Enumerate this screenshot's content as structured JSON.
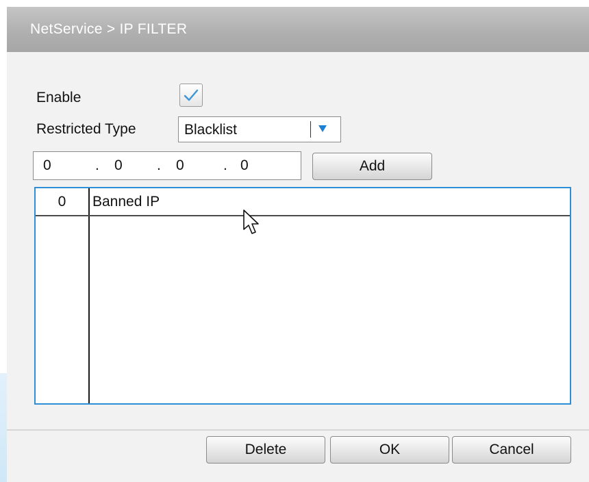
{
  "dialog": {
    "title": "NetService > IP FILTER"
  },
  "enable": {
    "label": "Enable",
    "checked": true,
    "icon": "checkmark-icon"
  },
  "restricted_type": {
    "label": "Restricted Type",
    "value": "Blacklist",
    "icon": "dropdown-arrow-icon"
  },
  "ip_input": {
    "octets": [
      "0",
      "0",
      "0",
      "0"
    ],
    "separator": "."
  },
  "buttons": {
    "add": "Add",
    "delete": "Delete",
    "ok": "OK",
    "cancel": "Cancel"
  },
  "table": {
    "count_header": "0",
    "ip_header": "Banned IP",
    "rows": []
  },
  "colors": {
    "accent": "#2f8fd6",
    "titlebar": "#b0b0b0",
    "dialog_background": "#f2f2f2"
  }
}
